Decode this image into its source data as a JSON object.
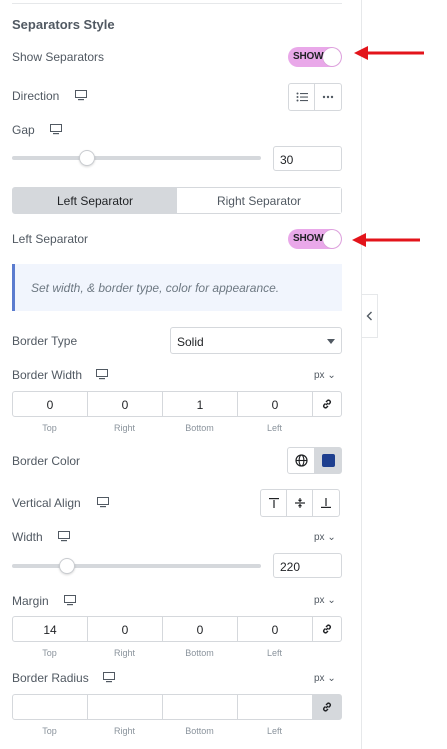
{
  "section": {
    "title": "Separators Style"
  },
  "show_separators": {
    "label": "Show Separators",
    "toggle_text": "SHOW",
    "on": true
  },
  "direction": {
    "label": "Direction",
    "options": [
      "list-icon",
      "more-horizontal-icon"
    ]
  },
  "gap": {
    "label": "Gap",
    "value": "30",
    "level": 0.28
  },
  "tabs": {
    "left": "Left Separator",
    "right": "Right Separator",
    "active": "left"
  },
  "left_separator": {
    "label": "Left Separator",
    "toggle_text": "SHOW",
    "on": true
  },
  "info": {
    "text": "Set width, & border type, color for appearance."
  },
  "border_type": {
    "label": "Border Type",
    "value": "Solid"
  },
  "border_width": {
    "label": "Border Width",
    "unit": "px ⌄",
    "values": [
      "0",
      "0",
      "1",
      "0"
    ],
    "sides": [
      "Top",
      "Right",
      "Bottom",
      "Left"
    ]
  },
  "border_color": {
    "label": "Border Color",
    "swatch": "#1e3f8f"
  },
  "vertical_align": {
    "label": "Vertical Align",
    "options": [
      "align-top-icon",
      "align-middle-icon",
      "align-bottom-icon"
    ]
  },
  "width": {
    "label": "Width",
    "unit": "px ⌄",
    "value": "220",
    "level": 0.22
  },
  "margin": {
    "label": "Margin",
    "unit": "px ⌄",
    "values": [
      "14",
      "0",
      "0",
      "0"
    ],
    "sides": [
      "Top",
      "Right",
      "Bottom",
      "Left"
    ]
  },
  "border_radius": {
    "label": "Border Radius",
    "unit": "px ⌄",
    "values": [
      "",
      "",
      "",
      ""
    ],
    "sides": [
      "Top",
      "Right",
      "Bottom",
      "Left"
    ]
  },
  "colors": {
    "toggle": "#e9a8e9",
    "annotation_arrow": "#e3141b",
    "info_border": "#5b7ccf"
  }
}
